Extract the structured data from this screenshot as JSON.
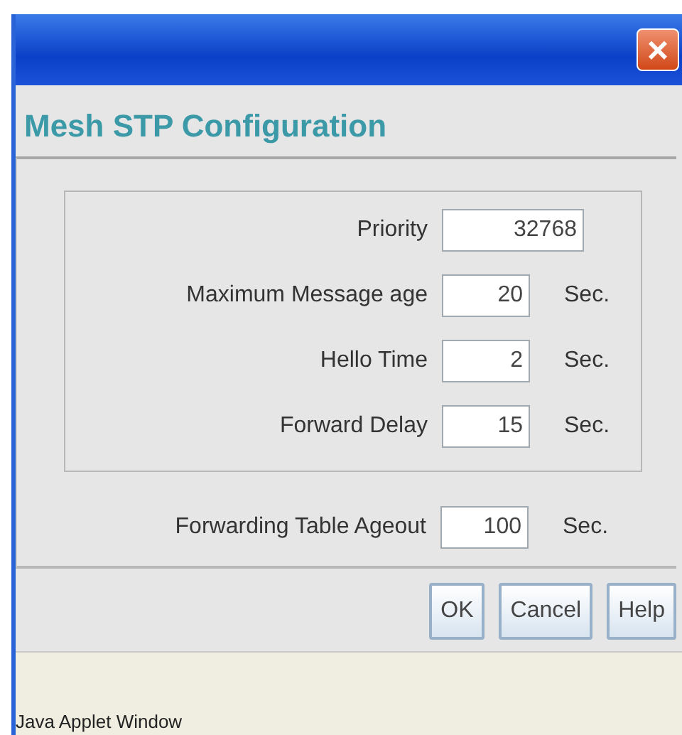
{
  "window": {
    "close_symbol": "×"
  },
  "heading": "Mesh STP Configuration",
  "group_fields": [
    {
      "label": "Priority",
      "value": "32768",
      "kind": "wide"
    },
    {
      "label": "Maximum Message age",
      "value": "20",
      "unit": "Sec.",
      "kind": "narrow"
    },
    {
      "label": "Hello Time",
      "value": "2",
      "unit": "Sec.",
      "kind": "narrow"
    },
    {
      "label": "Forward Delay",
      "value": "15",
      "unit": "Sec.",
      "kind": "narrow"
    }
  ],
  "fields": [
    {
      "label": "Forwarding Table Ageout",
      "value": "100",
      "unit": "Sec.",
      "kind": "narrow"
    }
  ],
  "buttons": [
    "OK",
    "Cancel",
    "Help"
  ],
  "status_bar": "Java Applet Window"
}
